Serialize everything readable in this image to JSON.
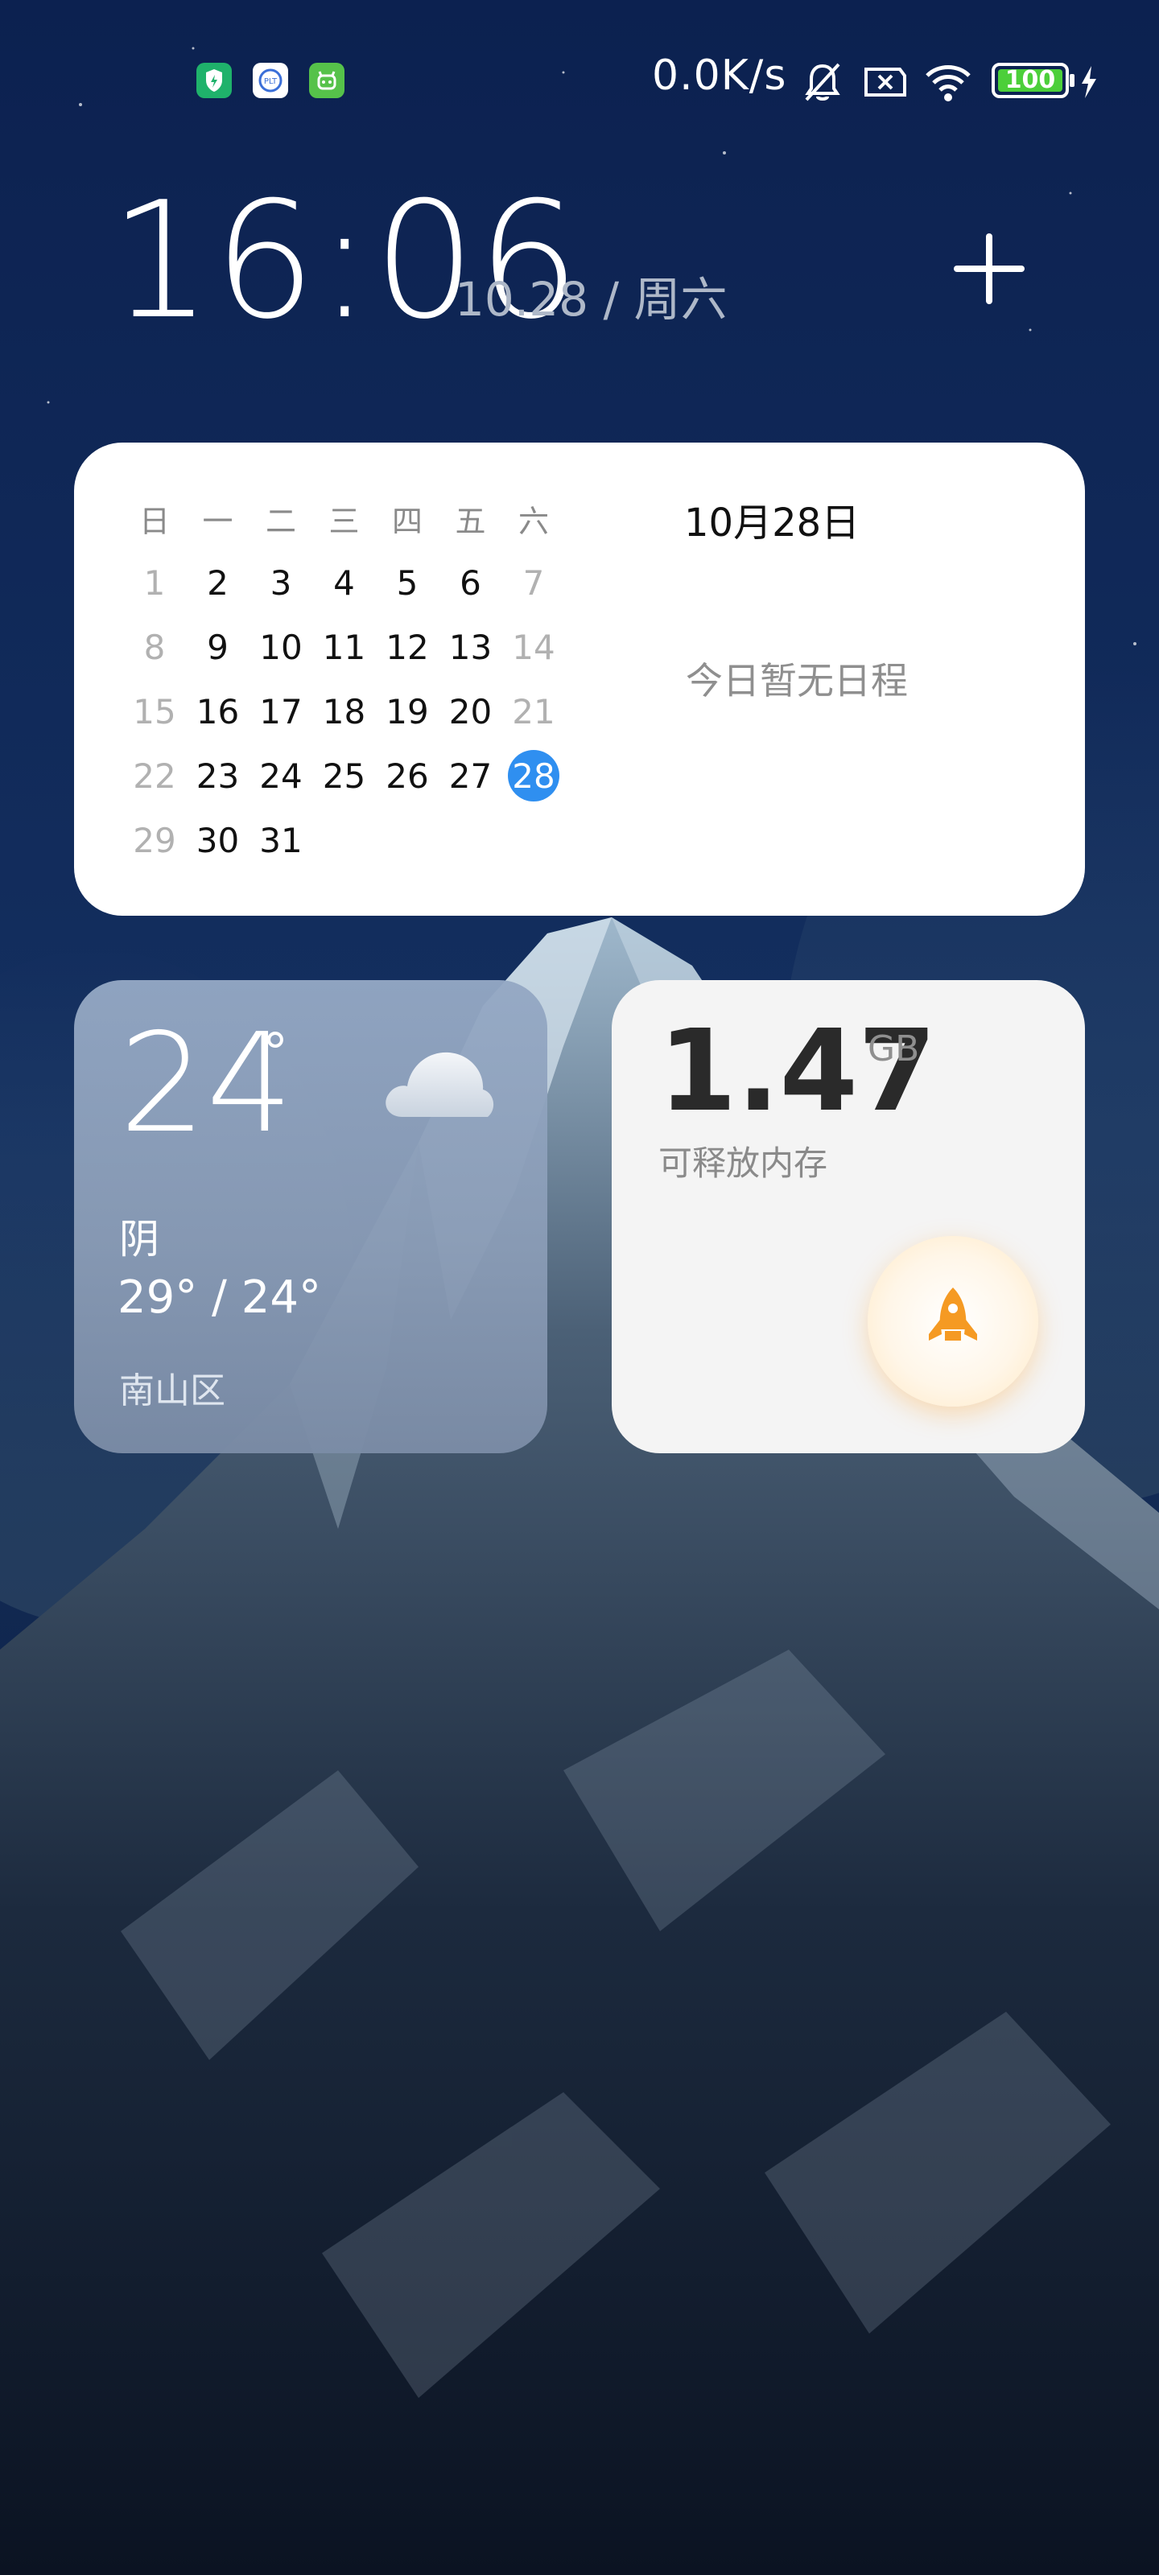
{
  "status_bar": {
    "net_speed": "0.0K/s",
    "battery": "100",
    "notif_icons": [
      "shield-bolt-icon",
      "plt-app-icon",
      "robot-app-icon"
    ]
  },
  "clock": {
    "time": "16:06",
    "date": "10.28 / 周六"
  },
  "calendar": {
    "weekday_headers": [
      "日",
      "一",
      "二",
      "三",
      "四",
      "五",
      "六"
    ],
    "weeks": [
      [
        "1",
        "2",
        "3",
        "4",
        "5",
        "6",
        "7"
      ],
      [
        "8",
        "9",
        "10",
        "11",
        "12",
        "13",
        "14"
      ],
      [
        "15",
        "16",
        "17",
        "18",
        "19",
        "20",
        "21"
      ],
      [
        "22",
        "23",
        "24",
        "25",
        "26",
        "27",
        "28"
      ],
      [
        "29",
        "30",
        "31"
      ]
    ],
    "today": "28",
    "title": "10月28日",
    "empty_text": "今日暂无日程"
  },
  "weather": {
    "temperature": "24",
    "degree_symbol": "°",
    "condition": "阴",
    "range": "29° / 24°",
    "location": "南山区",
    "icon": "cloud-icon"
  },
  "memory": {
    "value": "1.47",
    "unit": "GB",
    "label": "可释放内存",
    "button_icon": "rocket-icon"
  },
  "colors": {
    "accent_blue": "#2f8ff0",
    "rocket_orange": "#f59a23",
    "wallpaper_sky": "#0d2248"
  }
}
